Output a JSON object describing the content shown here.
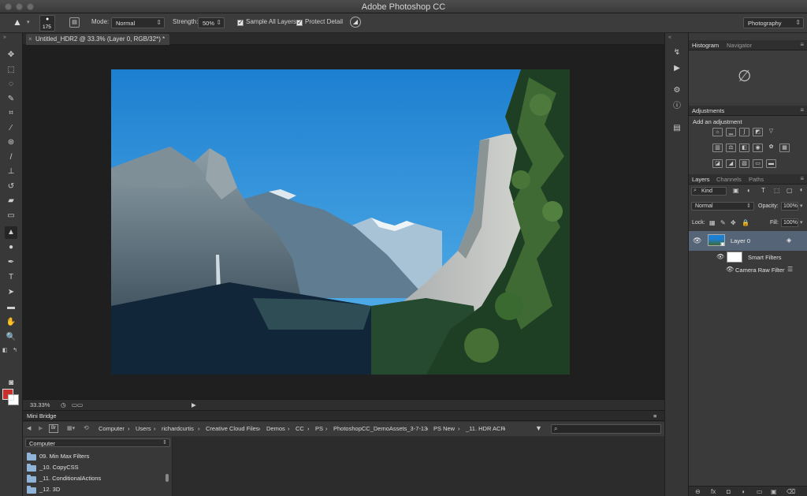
{
  "app": {
    "title": "Adobe Photoshop CC"
  },
  "options": {
    "brush_size": "175",
    "mode_label": "Mode:",
    "mode_value": "Normal",
    "strength_label": "Strength:",
    "strength_value": "50%",
    "sample_all_layers": "Sample All Layers",
    "protect_detail": "Protect Detail",
    "workspace": "Photography"
  },
  "document": {
    "tab_title": "Untitled_HDR2 @ 33.3% (Layer 0, RGB/32*) *",
    "zoom": "33.33%"
  },
  "panels": {
    "histogram_tab": "Histogram",
    "navigator_tab": "Navigator",
    "adjustments_tab": "Adjustments",
    "add_adjustment": "Add an adjustment",
    "layers_tab": "Layers",
    "channels_tab": "Channels",
    "paths_tab": "Paths",
    "kind_filter": "Kind",
    "blend_mode": "Normal",
    "opacity_label": "Opacity:",
    "opacity_value": "100%",
    "lock_label": "Lock:",
    "fill_label": "Fill:",
    "fill_value": "100%",
    "layers": [
      {
        "name": "Layer 0"
      },
      {
        "name": "Smart Filters"
      },
      {
        "name": "Camera Raw Filter"
      }
    ],
    "bottom_icons": [
      "⊖",
      "fx",
      "◘",
      "◑",
      "▭",
      "▣",
      "⌫"
    ]
  },
  "bridge": {
    "title": "Mini Bridge",
    "breadcrumbs": [
      "Computer",
      "Users",
      "richardcurtis",
      "Creative Cloud Files",
      "Demos",
      "CC",
      "PS",
      "PhotoshopCC_DemoAssets_3-7-13",
      "PS New",
      "_11. HDR ACR"
    ],
    "source": "Computer",
    "folders": [
      "09. Min Max Filters",
      "_10. CopyCSS",
      "_11. ConditionalActions",
      "_12. 3D"
    ]
  },
  "colors": {
    "foreground": "#c8302e",
    "background": "#ffffff",
    "selection": "#566478"
  }
}
